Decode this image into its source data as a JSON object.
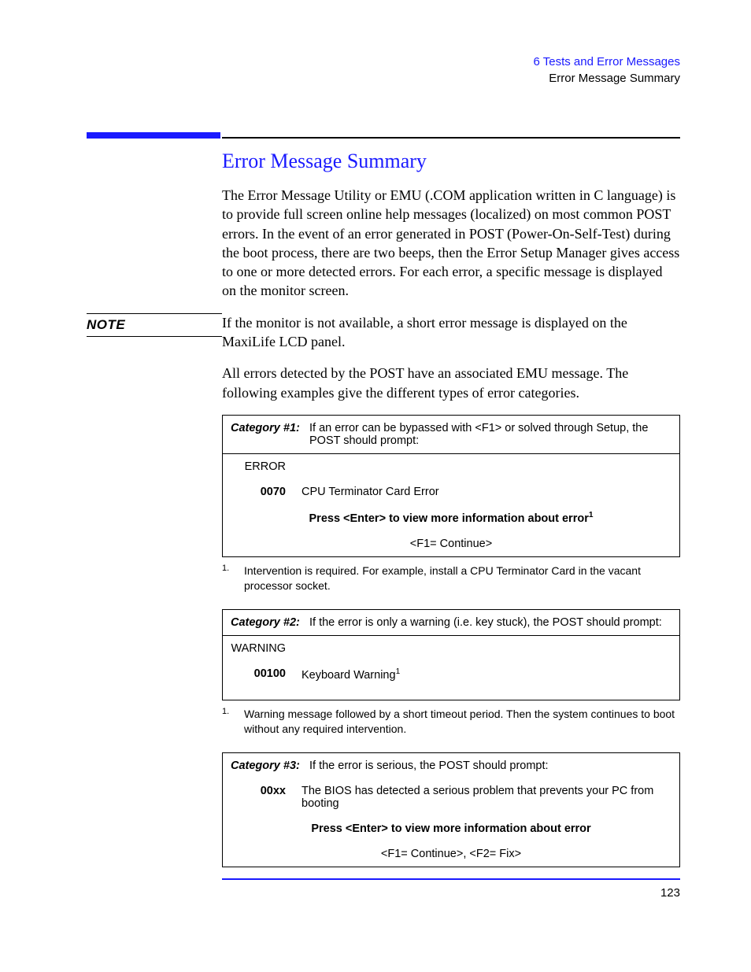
{
  "header": {
    "chapter": "6   Tests and Error Messages",
    "section": "Error Message Summary"
  },
  "title": "Error Message Summary",
  "para1": "The Error Message Utility or EMU (.COM application written in C language) is to provide full screen online help messages (localized) on most common POST errors. In the event of an error generated in POST (Power-On-Self-Test) during the boot process, there are two beeps, then the Error Setup Manager gives access to one or more detected errors. For each error, a specific message is displayed on the monitor screen.",
  "note": {
    "label": "NOTE",
    "text": "If the monitor is not available, a short error message is displayed on the MaxiLife LCD panel."
  },
  "para2": "All errors detected by the POST have an associated EMU message. The following examples give the different types of error categories.",
  "cat1": {
    "label": "Category #1:",
    "desc": "If an error can be bypassed with <F1> or solved through Setup, the POST should prompt:",
    "kind": "ERROR",
    "code": "0070",
    "msg": "CPU Terminator Card Error",
    "press_prefix": "Press <Enter> to view more information about error",
    "sup": "1",
    "cont": "<F1= Continue>"
  },
  "fn1": {
    "num": "1.",
    "text": "Intervention is required. For example, install a CPU Terminator Card in the vacant processor socket."
  },
  "cat2": {
    "label": "Category #2:",
    "desc": "If the error is only a warning (i.e. key stuck), the POST should prompt:",
    "kind": "WARNING",
    "code": "00100",
    "msg": "Keyboard Warning",
    "sup": "1"
  },
  "fn2": {
    "num": "1.",
    "text": "Warning message followed by a short timeout period. Then the system continues to boot without any required intervention."
  },
  "cat3": {
    "label": "Category #3:",
    "desc": "If the error is serious, the POST should prompt:",
    "code": "00xx",
    "msg": "The BIOS has detected a serious problem that prevents your PC from booting",
    "press": "Press <Enter> to view more information about error",
    "cont": "<F1= Continue>, <F2= Fix>"
  },
  "pagenum": "123"
}
